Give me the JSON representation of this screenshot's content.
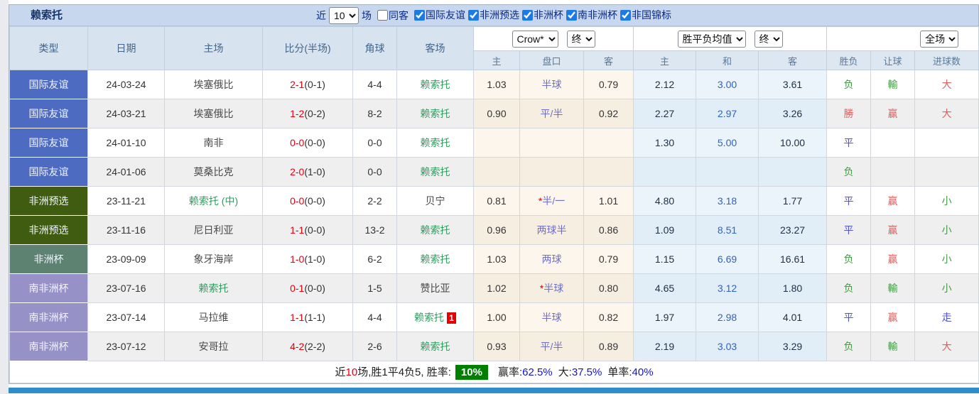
{
  "page": {
    "team_title": "赖索托"
  },
  "filter_bar": {
    "near_label": "近",
    "matches_select_value": "10",
    "matches_label": "场",
    "same_opponent_label": "同客",
    "same_opponent_checked": false,
    "competitions": [
      {
        "label": "国际友谊",
        "checked": true
      },
      {
        "label": "非洲预选",
        "checked": true
      },
      {
        "label": "非洲杯",
        "checked": true
      },
      {
        "label": "南非洲杯",
        "checked": true
      },
      {
        "label": "非国锦标",
        "checked": true
      }
    ]
  },
  "table": {
    "columns": [
      "类型",
      "日期",
      "主场",
      "比分(半场)",
      "角球",
      "客场"
    ],
    "odds_selects": {
      "bookmaker": "Crow*",
      "bookmaker_time": "终",
      "europe": "胜平负均值",
      "europe_time": "终",
      "scope": "全场"
    },
    "sub_columns": [
      "主",
      "盘口",
      "客",
      "主",
      "和",
      "客",
      "胜负",
      "让球",
      "进球数"
    ],
    "type_colors": {
      "国际友谊": "#4d6cc1",
      "非洲预选": "#3f5c10",
      "非洲杯": "#5d8271",
      "南非洲杯": "#9691c7"
    },
    "rows": [
      {
        "type": "国际友谊",
        "date": "24-03-24",
        "home": "埃塞俄比",
        "home_green": false,
        "score": "2-1",
        "half": "(0-1)",
        "corner": "4-4",
        "away": "赖索托",
        "away_green": true,
        "away_card": "",
        "asian_home": "1.03",
        "handicap": "半球",
        "handicap_star": false,
        "asian_away": "0.79",
        "euro_home": "2.12",
        "euro_draw": "3.00",
        "euro_away": "3.61",
        "result": "负",
        "result_color": "green",
        "handicap_result": "輸",
        "handicap_result_color": "green",
        "goals": "大",
        "goals_color": "red"
      },
      {
        "type": "国际友谊",
        "date": "24-03-21",
        "home": "埃塞俄比",
        "home_green": false,
        "score": "1-2",
        "half": "(0-2)",
        "corner": "8-2",
        "away": "赖索托",
        "away_green": true,
        "away_card": "",
        "asian_home": "0.90",
        "handicap": "平/半",
        "handicap_star": false,
        "asian_away": "0.92",
        "euro_home": "2.27",
        "euro_draw": "2.97",
        "euro_away": "3.26",
        "result": "勝",
        "result_color": "red",
        "handicap_result": "赢",
        "handicap_result_color": "red",
        "goals": "大",
        "goals_color": "red"
      },
      {
        "type": "国际友谊",
        "date": "24-01-10",
        "home": "南非",
        "home_green": false,
        "score": "0-0",
        "half": "(0-0)",
        "corner": "0-0",
        "away": "赖索托",
        "away_green": true,
        "away_card": "",
        "asian_home": "",
        "handicap": "",
        "handicap_star": false,
        "asian_away": "",
        "euro_home": "1.30",
        "euro_draw": "5.00",
        "euro_away": "10.00",
        "result": "平",
        "result_color": "blue",
        "handicap_result": "",
        "handicap_result_color": "blue",
        "goals": "",
        "goals_color": "blue"
      },
      {
        "type": "国际友谊",
        "date": "24-01-06",
        "home": "莫桑比克",
        "home_green": false,
        "score": "2-0",
        "half": "(1-0)",
        "corner": "0-0",
        "away": "赖索托",
        "away_green": true,
        "away_card": "",
        "asian_home": "",
        "handicap": "",
        "handicap_star": false,
        "asian_away": "",
        "euro_home": "",
        "euro_draw": "",
        "euro_away": "",
        "result": "负",
        "result_color": "green",
        "handicap_result": "",
        "handicap_result_color": "green",
        "goals": "",
        "goals_color": "green"
      },
      {
        "type": "非洲预选",
        "date": "23-11-21",
        "home": "赖索托 (中)",
        "home_green": true,
        "score": "0-0",
        "half": "(0-0)",
        "corner": "2-2",
        "away": "贝宁",
        "away_green": false,
        "away_card": "",
        "asian_home": "0.81",
        "handicap": "半/一",
        "handicap_star": true,
        "asian_away": "1.01",
        "euro_home": "4.80",
        "euro_draw": "3.18",
        "euro_away": "1.77",
        "result": "平",
        "result_color": "blue",
        "handicap_result": "赢",
        "handicap_result_color": "red",
        "goals": "小",
        "goals_color": "green"
      },
      {
        "type": "非洲预选",
        "date": "23-11-16",
        "home": "尼日利亚",
        "home_green": false,
        "score": "1-1",
        "half": "(0-0)",
        "corner": "13-2",
        "away": "赖索托",
        "away_green": true,
        "away_card": "",
        "asian_home": "0.96",
        "handicap": "两球半",
        "handicap_star": false,
        "asian_away": "0.86",
        "euro_home": "1.09",
        "euro_draw": "8.51",
        "euro_away": "23.27",
        "result": "平",
        "result_color": "blue",
        "handicap_result": "赢",
        "handicap_result_color": "red",
        "goals": "小",
        "goals_color": "green"
      },
      {
        "type": "非洲杯",
        "date": "23-09-09",
        "home": "象牙海岸",
        "home_green": false,
        "score": "1-0",
        "half": "(1-0)",
        "corner": "6-2",
        "away": "赖索托",
        "away_green": true,
        "away_card": "",
        "asian_home": "1.03",
        "handicap": "两球",
        "handicap_star": false,
        "asian_away": "0.79",
        "euro_home": "1.15",
        "euro_draw": "6.69",
        "euro_away": "16.61",
        "result": "负",
        "result_color": "green",
        "handicap_result": "赢",
        "handicap_result_color": "red",
        "goals": "小",
        "goals_color": "green"
      },
      {
        "type": "南非洲杯",
        "date": "23-07-16",
        "home": "赖索托",
        "home_green": true,
        "score": "0-1",
        "half": "(0-0)",
        "corner": "1-5",
        "away": "赞比亚",
        "away_green": false,
        "away_card": "",
        "asian_home": "1.02",
        "handicap": "半球",
        "handicap_star": true,
        "asian_away": "0.80",
        "euro_home": "4.65",
        "euro_draw": "3.12",
        "euro_away": "1.80",
        "result": "负",
        "result_color": "green",
        "handicap_result": "輸",
        "handicap_result_color": "green",
        "goals": "小",
        "goals_color": "green"
      },
      {
        "type": "南非洲杯",
        "date": "23-07-14",
        "home": "马拉维",
        "home_green": false,
        "score": "1-1",
        "half": "(1-1)",
        "corner": "4-4",
        "away": "赖索托",
        "away_green": true,
        "away_card": "1",
        "asian_home": "1.00",
        "handicap": "半球",
        "handicap_star": false,
        "asian_away": "0.82",
        "euro_home": "1.97",
        "euro_draw": "2.98",
        "euro_away": "4.01",
        "result": "平",
        "result_color": "blue",
        "handicap_result": "赢",
        "handicap_result_color": "red",
        "goals": "走",
        "goals_color": "blue"
      },
      {
        "type": "南非洲杯",
        "date": "23-07-12",
        "home": "安哥拉",
        "home_green": false,
        "score": "4-2",
        "half": "(2-2)",
        "corner": "2-6",
        "away": "赖索托",
        "away_green": true,
        "away_card": "",
        "asian_home": "0.93",
        "handicap": "平/半",
        "handicap_star": false,
        "asian_away": "0.89",
        "euro_home": "2.19",
        "euro_draw": "3.03",
        "euro_away": "3.29",
        "result": "负",
        "result_color": "green",
        "handicap_result": "輸",
        "handicap_result_color": "green",
        "goals": "大",
        "goals_color": "red"
      }
    ]
  },
  "footer": {
    "near": "近",
    "count": "10",
    "stats": "场,胜1平4负5, 胜率:",
    "rate_badge": "10%",
    "win_label": "赢率:",
    "win_value": "62.5%",
    "big_label": "大:",
    "big_value": "37.5%",
    "single_label": "单率:",
    "single_value": "40%"
  }
}
